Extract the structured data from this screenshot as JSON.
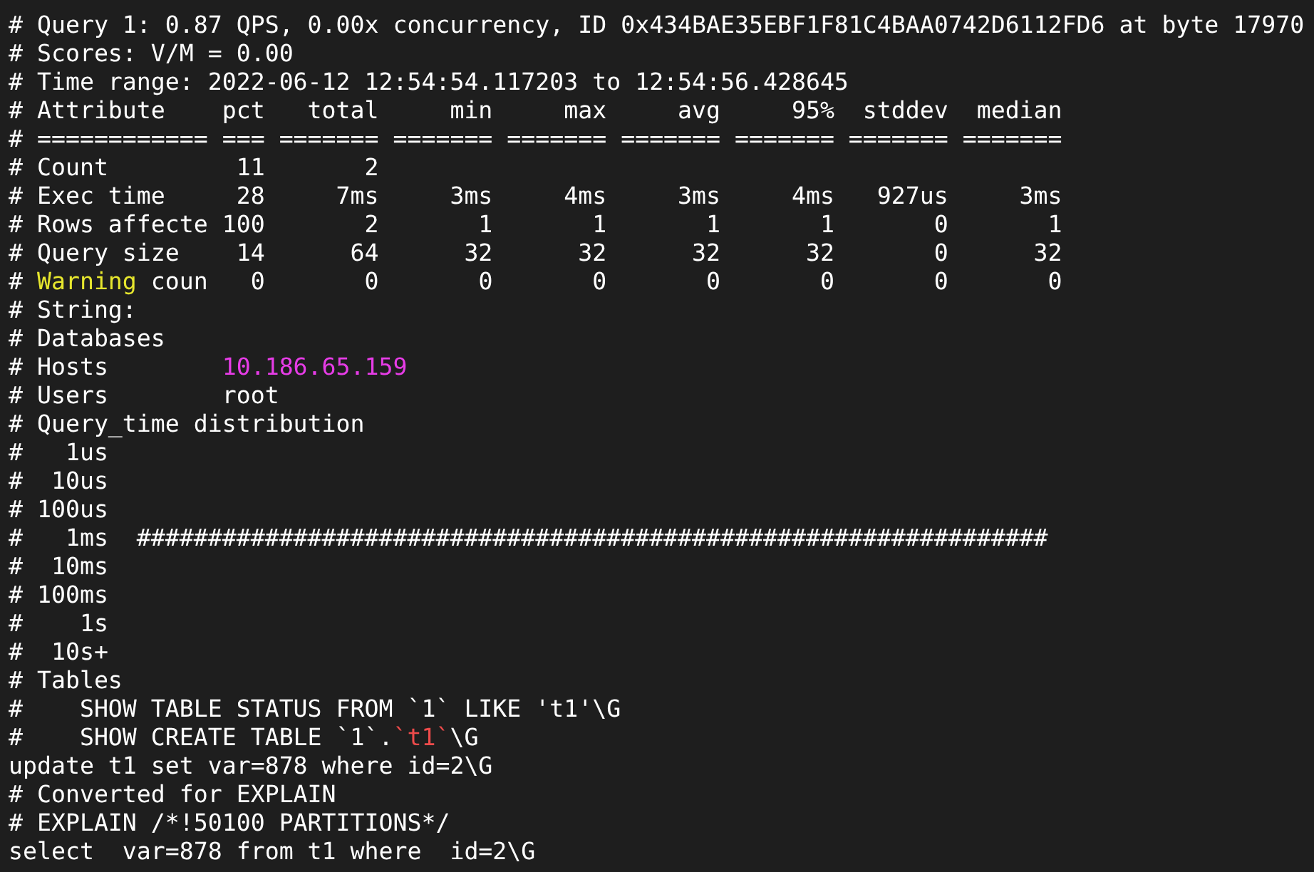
{
  "terminal": {
    "lines": [
      {
        "parts": [
          {
            "text": "# Query 1: 0.87 QPS, 0.00x concurrency, ID 0x434BAE35EBF1F81C4BAA0742D6112FD6 at byte 17970",
            "color": "#ffffff"
          }
        ]
      },
      {
        "parts": [
          {
            "text": "# Scores: V/M = 0.00",
            "color": "#ffffff"
          }
        ]
      },
      {
        "parts": [
          {
            "text": "# Time range: 2022-06-12 12:54:54.117203 to 12:54:56.428645",
            "color": "#ffffff"
          }
        ]
      },
      {
        "parts": [
          {
            "text": "# Attribute    pct   total     min     max     avg     95%  stddev  median",
            "color": "#ffffff"
          }
        ]
      },
      {
        "parts": [
          {
            "text": "# ============ === ======= ======= ======= ======= ======= ======= =======",
            "color": "#ffffff"
          }
        ]
      },
      {
        "parts": [
          {
            "text": "# Count         11       2",
            "color": "#ffffff"
          }
        ]
      },
      {
        "parts": [
          {
            "text": "# Exec time     28     7ms     3ms     4ms     3ms     4ms   927us     3ms",
            "color": "#ffffff"
          }
        ]
      },
      {
        "parts": [
          {
            "text": "# Rows affecte 100       2       1       1       1       1       0       1",
            "color": "#ffffff"
          }
        ]
      },
      {
        "parts": [
          {
            "text": "# Query size    14      64      32      32      32      32       0      32",
            "color": "#ffffff"
          }
        ]
      },
      {
        "parts": [
          {
            "text": "# ",
            "color": "#ffffff"
          },
          {
            "text": "Warning",
            "color": "#e6e62e"
          },
          {
            "text": " coun   0       0       0       0       0       0       0       0",
            "color": "#ffffff"
          }
        ]
      },
      {
        "parts": [
          {
            "text": "# String:",
            "color": "#ffffff"
          }
        ]
      },
      {
        "parts": [
          {
            "text": "# Databases",
            "color": "#ffffff"
          }
        ]
      },
      {
        "parts": [
          {
            "text": "# Hosts        ",
            "color": "#ffffff"
          },
          {
            "text": "10.186.65.159",
            "color": "#e63ce6"
          }
        ]
      },
      {
        "parts": [
          {
            "text": "# Users        root",
            "color": "#ffffff"
          }
        ]
      },
      {
        "parts": [
          {
            "text": "# Query_time distribution",
            "color": "#ffffff"
          }
        ]
      },
      {
        "parts": [
          {
            "text": "#   1us",
            "color": "#ffffff"
          }
        ]
      },
      {
        "parts": [
          {
            "text": "#  10us",
            "color": "#ffffff"
          }
        ]
      },
      {
        "parts": [
          {
            "text": "# 100us",
            "color": "#ffffff"
          }
        ]
      },
      {
        "parts": [
          {
            "text": "#   1ms  ################################################################",
            "color": "#ffffff"
          }
        ]
      },
      {
        "parts": [
          {
            "text": "#  10ms",
            "color": "#ffffff"
          }
        ]
      },
      {
        "parts": [
          {
            "text": "# 100ms",
            "color": "#ffffff"
          }
        ]
      },
      {
        "parts": [
          {
            "text": "#    1s",
            "color": "#ffffff"
          }
        ]
      },
      {
        "parts": [
          {
            "text": "#  10s+",
            "color": "#ffffff"
          }
        ]
      },
      {
        "parts": [
          {
            "text": "# Tables",
            "color": "#ffffff"
          }
        ]
      },
      {
        "parts": [
          {
            "text": "#    SHOW TABLE STATUS FROM `1` LIKE 't1'\\G",
            "color": "#ffffff"
          }
        ]
      },
      {
        "parts": [
          {
            "text": "#    SHOW CREATE TABLE `1`.",
            "color": "#ffffff"
          },
          {
            "text": "`t1`",
            "color": "#ee4b4b"
          },
          {
            "text": "\\G",
            "color": "#ffffff"
          }
        ]
      },
      {
        "parts": [
          {
            "text": "update t1 set var=878 where id=2\\G",
            "color": "#ffffff"
          }
        ]
      },
      {
        "parts": [
          {
            "text": "# Converted for EXPLAIN",
            "color": "#ffffff"
          }
        ]
      },
      {
        "parts": [
          {
            "text": "# EXPLAIN /*!50100 PARTITIONS*/",
            "color": "#ffffff"
          }
        ]
      },
      {
        "parts": [
          {
            "text": "select  var=878 from t1 where  id=2\\G",
            "color": "#ffffff"
          }
        ]
      }
    ]
  }
}
